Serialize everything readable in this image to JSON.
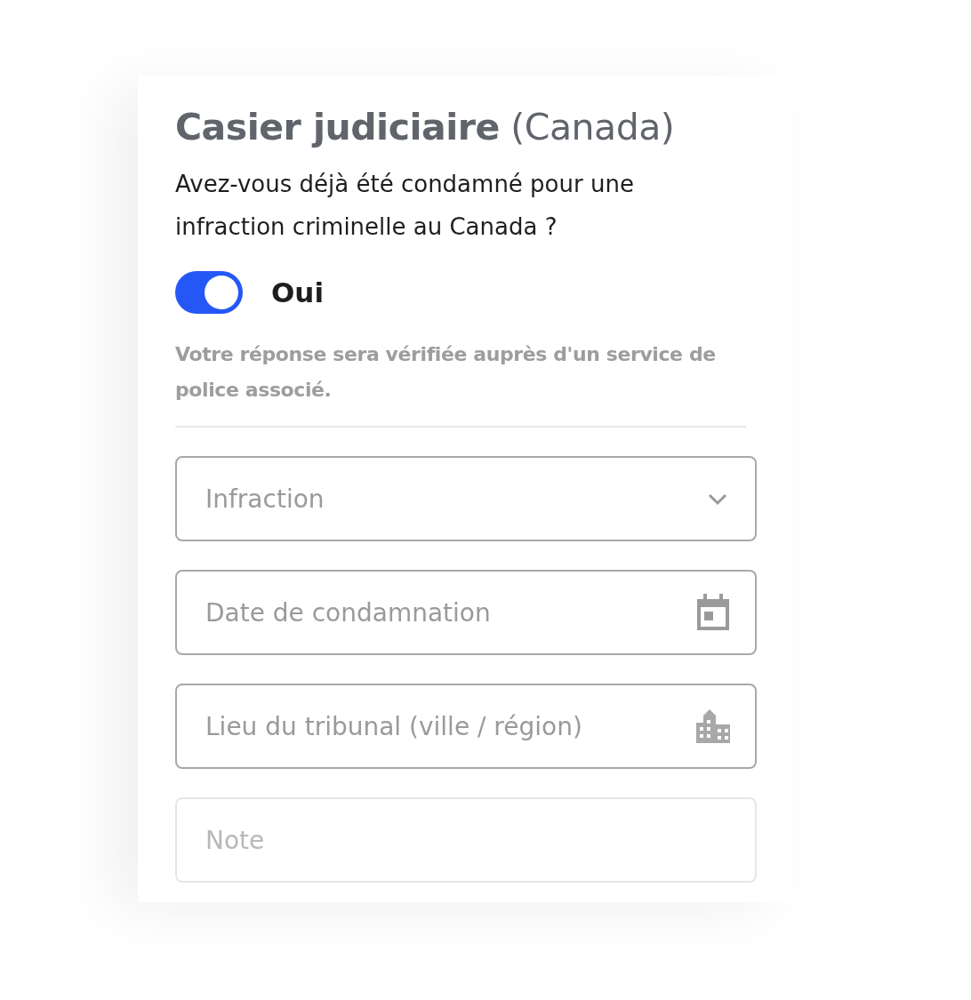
{
  "title": "**Casier judiciaire** (Canada)",
  "question": "Avez-vous déjà été condamné pour une infraction criminelle au Canada ?",
  "toggle": {
    "label": "Oui",
    "on": true
  },
  "notice": "Votre réponse sera vérifiée auprès d'un service de police associé.",
  "fields": [
    {
      "kind": "select",
      "placeholder": "Infraction"
    },
    {
      "kind": "date",
      "placeholder": "Date de condamnation"
    },
    {
      "kind": "location",
      "placeholder": "Lieu du tribunal (ville / région)"
    },
    {
      "kind": "text",
      "placeholder": "Note"
    }
  ]
}
